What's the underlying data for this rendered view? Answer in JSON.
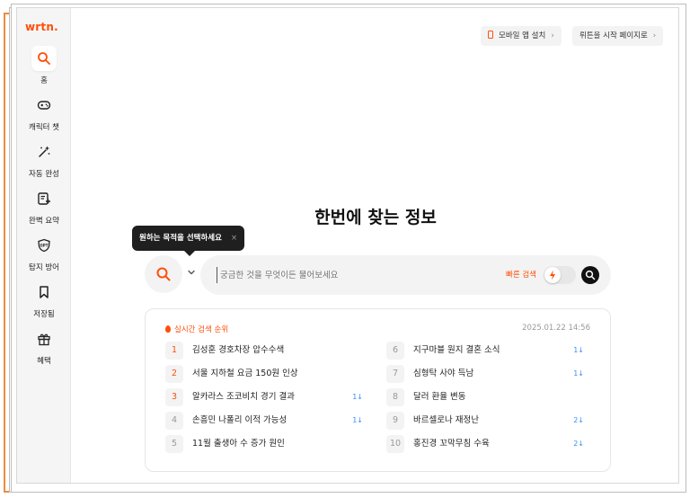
{
  "brand": {
    "logo": "wrtn.",
    "accent": "#ff4e0a"
  },
  "sidebar": {
    "items": [
      {
        "label": "홈",
        "icon": "search-icon",
        "active": true
      },
      {
        "label": "캐릭터 챗",
        "icon": "gamepad-icon",
        "active": false
      },
      {
        "label": "자동 완성",
        "icon": "magic-wand-icon",
        "active": false
      },
      {
        "label": "완벽 요약",
        "icon": "document-plus-icon",
        "active": false
      },
      {
        "label": "탐지 방어",
        "icon": "gpt-shield-icon",
        "active": false
      },
      {
        "label": "저장됨",
        "icon": "bookmark-icon",
        "active": false
      },
      {
        "label": "혜택",
        "icon": "gift-icon",
        "active": false
      }
    ]
  },
  "topbar": {
    "mobile_app": "모바일 앱 설치",
    "start_page": "뤼튼을 시작 페이지로",
    "chevron": "›"
  },
  "main": {
    "headline": "한번에 찾는 정보",
    "tooltip": {
      "text": "원하는 목적을 선택하세요",
      "close": "×"
    },
    "search": {
      "placeholder": "궁금한 것을 무엇이든 물어보세요",
      "quick_search_label": "빠른 검색",
      "quick_search_enabled": false
    }
  },
  "trending": {
    "title": "실시간 검색 순위",
    "timestamp": "2025.01.22 14:56",
    "items": [
      {
        "rank": "1",
        "text": "김성훈 경호차장 압수수색",
        "change": ""
      },
      {
        "rank": "2",
        "text": "서울 지하철 요금 150원 인상",
        "change": ""
      },
      {
        "rank": "3",
        "text": "알카라스 조코비치 경기 결과",
        "change": "1↓"
      },
      {
        "rank": "4",
        "text": "손흥민 나폴리 이적 가능성",
        "change": "1↓"
      },
      {
        "rank": "5",
        "text": "11월 출생아 수 증가 원인",
        "change": ""
      },
      {
        "rank": "6",
        "text": "지구마블 원지 결혼 소식",
        "change": "1↓"
      },
      {
        "rank": "7",
        "text": "심형탁 사야 득남",
        "change": "1↓"
      },
      {
        "rank": "8",
        "text": "달러 환율 변동",
        "change": ""
      },
      {
        "rank": "9",
        "text": "바르셀로나 재정난",
        "change": "2↓"
      },
      {
        "rank": "10",
        "text": "홍진경 꼬막무침 수육",
        "change": "2↓"
      }
    ]
  }
}
